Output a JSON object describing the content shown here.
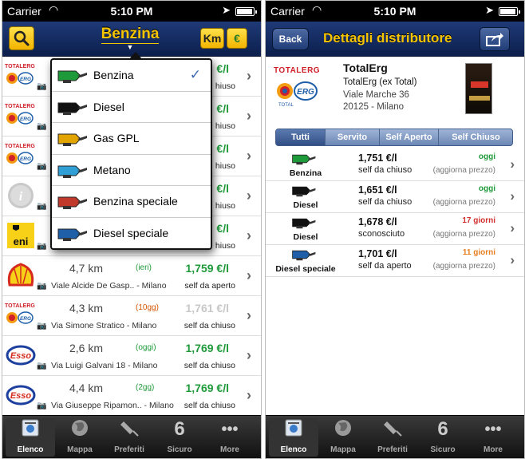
{
  "left": {
    "status": {
      "carrier": "Carrier",
      "time": "5:10 PM"
    },
    "nav": {
      "title": "Benzina",
      "km_label": "Km",
      "euro_label": "€"
    },
    "stations": [
      {
        "brand": "TotalErg",
        "dist": "",
        "age": "",
        "price": "€/l",
        "addr": "",
        "service": "hiuso"
      },
      {
        "brand": "TotalErg",
        "dist": "",
        "age": "",
        "price": "€/l",
        "addr": "",
        "service": "hiuso"
      },
      {
        "brand": "TotalErg",
        "dist": "",
        "age": "",
        "price": "€/l",
        "addr": "",
        "service": "hiuso"
      },
      {
        "brand": "Generic",
        "dist": "",
        "age": "",
        "price": "€/l",
        "addr": "",
        "service": "hiuso"
      },
      {
        "brand": "Eni",
        "dist": "",
        "age": "",
        "price": "€/l",
        "addr": "",
        "service": "hiuso"
      },
      {
        "brand": "Shell",
        "dist": "4,7 km",
        "age": "(ieri)",
        "price": "1,759 €/l",
        "addr": "Viale Alcide De Gasp.. - Milano",
        "service": "self da aperto"
      },
      {
        "brand": "TotalErg",
        "dist": "4,3 km",
        "age": "(10gg)",
        "price": "1,761 €/l",
        "addr": "Via Simone Stratico - Milano",
        "service": "self da chiuso"
      },
      {
        "brand": "Esso",
        "dist": "2,6 km",
        "age": "(oggi)",
        "price": "1,769 €/l",
        "addr": "Via Luigi Galvani 18 - Milano",
        "service": "self da chiuso"
      },
      {
        "brand": "Esso",
        "dist": "4,4 km",
        "age": "(2gg)",
        "price": "1,769 €/l",
        "addr": "Via Giuseppe Ripamon.. - Milano",
        "service": "self da chiuso"
      }
    ],
    "fuel_options": [
      {
        "label": "Benzina",
        "color": "#1f9a3a",
        "selected": true
      },
      {
        "label": "Diesel",
        "color": "#111111",
        "selected": false
      },
      {
        "label": "Gas GPL",
        "color": "#e2a400",
        "selected": false
      },
      {
        "label": "Metano",
        "color": "#2f9fd6",
        "selected": false
      },
      {
        "label": "Benzina speciale",
        "color": "#c0392b",
        "selected": false
      },
      {
        "label": "Diesel speciale",
        "color": "#1e5fa8",
        "selected": false
      }
    ],
    "checkmark": "✓",
    "tabs": [
      {
        "label": "Elenco",
        "icon": "list-icon"
      },
      {
        "label": "Mappa",
        "icon": "globe-icon"
      },
      {
        "label": "Preferiti",
        "icon": "pin-icon"
      },
      {
        "label": "Sicuro",
        "icon": "6"
      },
      {
        "label": "More",
        "icon": "more-icon"
      }
    ]
  },
  "right": {
    "status": {
      "carrier": "Carrier",
      "time": "5:10 PM"
    },
    "nav": {
      "back_label": "Back",
      "title": "Dettagli distributore"
    },
    "station": {
      "logo_text": "TOTALERG",
      "name": "TotalErg",
      "subtitle": "TotalErg (ex Total)",
      "address": "Viale Marche 36",
      "city": "20125 - Milano"
    },
    "segments": [
      "Tutti",
      "Servito",
      "Self Aperto",
      "Self Chiuso"
    ],
    "prices": [
      {
        "fuel": "Benzina",
        "color": "#1f9a3a",
        "price": "1,751 €/l",
        "service": "self da chiuso",
        "age": "oggi",
        "age_color": "#1f9a3a",
        "update": "(aggiorna prezzo)"
      },
      {
        "fuel": "Diesel",
        "color": "#111111",
        "price": "1,651 €/l",
        "service": "self da chiuso",
        "age": "oggi",
        "age_color": "#1f9a3a",
        "update": "(aggiorna prezzo)"
      },
      {
        "fuel": "Diesel",
        "color": "#111111",
        "price": "1,678 €/l",
        "service": "sconosciuto",
        "age": "17 giorni",
        "age_color": "#d32f2f",
        "update": "(aggiorna prezzo)"
      },
      {
        "fuel": "Diesel speciale",
        "color": "#1e5fa8",
        "price": "1,701 €/l",
        "service": "self da aperto",
        "age": "11 giorni",
        "age_color": "#e67e22",
        "update": "(aggiorna prezzo)"
      }
    ],
    "tabs": [
      {
        "label": "Elenco",
        "icon": "list-icon"
      },
      {
        "label": "Mappa",
        "icon": "globe-icon"
      },
      {
        "label": "Preferiti",
        "icon": "pin-icon"
      },
      {
        "label": "Sicuro",
        "icon": "6"
      },
      {
        "label": "More",
        "icon": "more-icon"
      }
    ]
  }
}
